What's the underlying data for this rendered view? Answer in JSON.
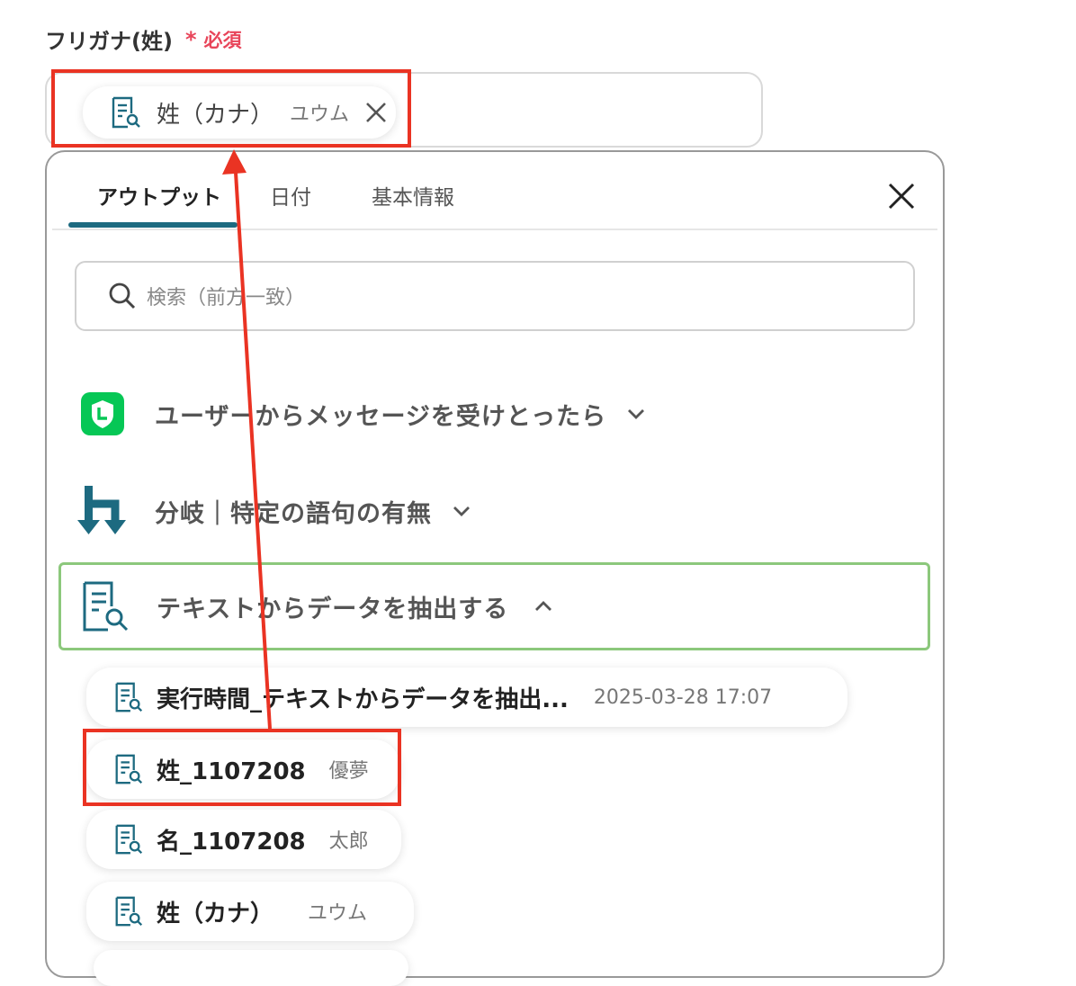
{
  "field": {
    "label": "フリガナ(姓)",
    "required_mark": "*",
    "required_text": "必須"
  },
  "selected_chip": {
    "name": "姓（カナ）",
    "value": "ユウム"
  },
  "tabs": [
    {
      "label": "アウトプット",
      "active": true
    },
    {
      "label": "日付",
      "active": false
    },
    {
      "label": "基本情報",
      "active": false
    }
  ],
  "search": {
    "placeholder": "検索（前方一致）"
  },
  "sections": [
    {
      "title": "ユーザーからメッセージを受けとったら",
      "expanded": false,
      "icon": "line-app-icon"
    },
    {
      "title": "分岐｜特定の語句の有無",
      "expanded": false,
      "icon": "branch-icon"
    },
    {
      "title": "テキストからデータを抽出する",
      "expanded": true,
      "icon": "document-search-icon"
    }
  ],
  "items": [
    {
      "name": "実行時間_テキストからデータを抽出...",
      "value": "2025-03-28 17:07"
    },
    {
      "name": "姓_1107208",
      "value": "優夢"
    },
    {
      "name": "名_1107208",
      "value": "太郎"
    },
    {
      "name": "姓（カナ）",
      "value": "ユウム"
    }
  ],
  "colors": {
    "accent": "#1d6a80",
    "required": "#e8455a",
    "highlight_box": "#ea3323",
    "active_section_border": "#8cc87c",
    "line_green": "#06c755"
  }
}
